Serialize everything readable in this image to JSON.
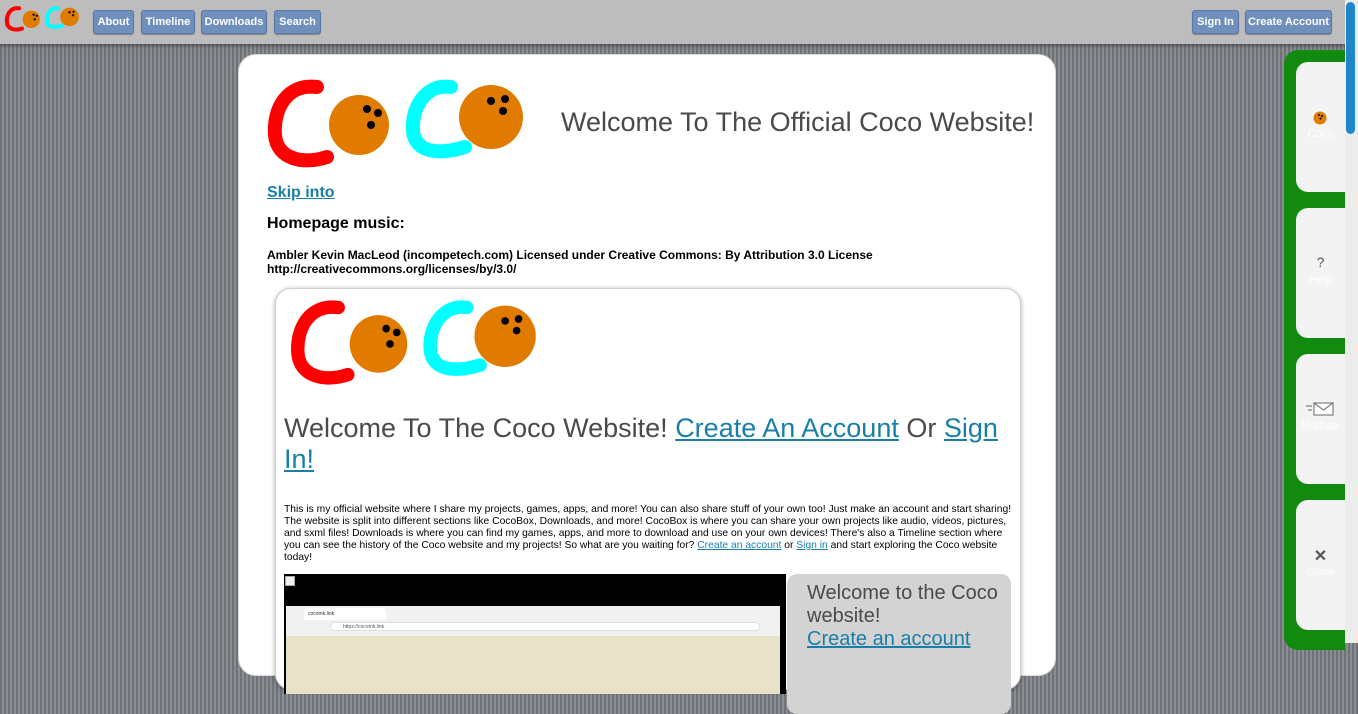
{
  "topbar": {
    "logo_text": "COCO",
    "nav": [
      {
        "label": "About"
      },
      {
        "label": "Timeline"
      },
      {
        "label": "Downloads"
      },
      {
        "label": "Search"
      }
    ],
    "sign_in": "Sign In",
    "create_account": "Create Account"
  },
  "main": {
    "logo_text": "COCO",
    "title": "Welcome To The Official Coco Website!",
    "skip_link": "Skip into",
    "music_heading": "Homepage music:",
    "credit_line1": "Ambler Kevin MacLeod (incompetech.com) Licensed under Creative Commons: By Attribution 3.0 License",
    "credit_line2": "http://creativecommons.org/licenses/by/3.0/"
  },
  "inner": {
    "logo_text": "COCO",
    "heading_prefix": "Welcome To The Coco Website! ",
    "heading_link1": "Create An Account",
    "heading_middle": " Or ",
    "heading_link2": "Sign In!",
    "para_text": "This is my official website where I share my projects, games, apps, and more! You can also share stuff of your own too! Just make an account and start sharing! The website is split into different sections like CocoBox, Downloads, and more! CocoBox is where you can share your own projects like audio, videos, pictures, and sxml files! Downloads is where you can find my games, apps, and more to download and use on your own devices! There's also a Timeline section where you can see the history of the Coco website and my projects! So what are you waiting for? ",
    "para_link1": "Create an account",
    "para_or": " or ",
    "para_link2": "Sign in",
    "para_end": " and start exploring the Coco website today!",
    "screenshot": {
      "tab_title": "cocomk.link",
      "address": "https://cocomk.link"
    },
    "side_panel": {
      "text": "Welcome to the Coco website!",
      "link": "Create an account"
    }
  },
  "dock": {
    "items": [
      {
        "label": "Coco",
        "icon": "coconut-icon"
      },
      {
        "label": "Help",
        "icon": "question-icon"
      },
      {
        "label": "Mailbox",
        "icon": "mail-icon"
      },
      {
        "label": "Close",
        "icon": "close-icon"
      }
    ]
  },
  "colors": {
    "red": "#ff0000",
    "cyan": "#00ffff",
    "coconut": "#e07b00",
    "link": "#1a7fa8",
    "dock_green": "#118a0f",
    "nav_button": "#6f8fbd",
    "scrollbar": "#1f86c8"
  }
}
